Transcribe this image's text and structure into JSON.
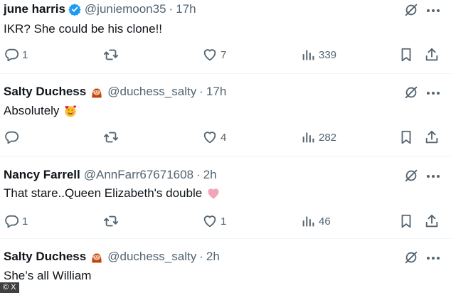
{
  "tweets": [
    {
      "name": "june harris",
      "verified": true,
      "handle": "@juniemoon35",
      "separator": "·",
      "time": "17h",
      "text": "IKR? She could be his clone!!",
      "replies": "1",
      "retweets": "",
      "likes": "7",
      "views": "339"
    },
    {
      "name": "Salty Duchess",
      "avatar_emoji": "woman-red-hair-emoji",
      "handle": "@duchess_salty",
      "separator": "·",
      "time": "17h",
      "text": "Absolutely",
      "text_emoji": "smiling-face-with-hearts-emoji",
      "replies": "",
      "retweets": "",
      "likes": "4",
      "views": "282"
    },
    {
      "name": "Nancy Farrell",
      "handle": "@AnnFarr67671608",
      "separator": "·",
      "time": "2h",
      "text": "That stare..Queen Elizabeth's double",
      "text_emoji": "pink-heart-emoji",
      "replies": "1",
      "retweets": "",
      "likes": "1",
      "views": "46"
    },
    {
      "name": "Salty Duchess",
      "avatar_emoji": "woman-red-hair-emoji",
      "handle": "@duchess_salty",
      "separator": "·",
      "time": "2h",
      "text": "She’s all William"
    }
  ],
  "watermark": "© X",
  "colors": {
    "text": "#0f1419",
    "muted": "#536471",
    "verified": "#1d9bf0",
    "divider": "#eff3f4"
  }
}
